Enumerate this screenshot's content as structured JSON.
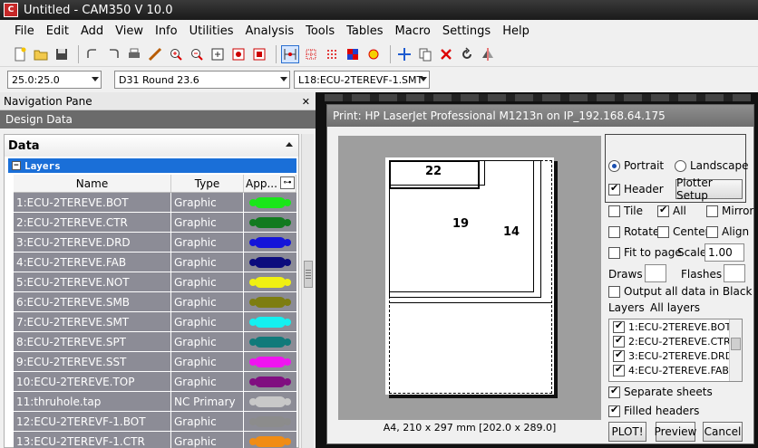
{
  "window": {
    "title": "Untitled - CAM350 V 10.0",
    "app_icon": "cam350-icon"
  },
  "menu": [
    "File",
    "Edit",
    "Add",
    "View",
    "Info",
    "Utilities",
    "Analysis",
    "Tools",
    "Tables",
    "Macro",
    "Settings",
    "Help"
  ],
  "toolbar": {
    "icons": [
      "new-icon",
      "open-icon",
      "save-icon",
      "undo-icon",
      "redo-icon",
      "print-icon",
      "measure-icon",
      "zoom-in-icon",
      "zoom-out-icon",
      "zoom-window-icon",
      "zoom-all-icon",
      "redraw-icon",
      "snap-grid-icon",
      "grid-icon",
      "grid-dots-icon",
      "layer-color-icon",
      "highlight-icon",
      "move-icon",
      "copy-icon",
      "delete-icon",
      "rotate-icon",
      "mirror-icon"
    ]
  },
  "selectors": {
    "grid": "25.0:25.0",
    "aperture": "D31   Round 23.6",
    "layer": "L18:ECU-2TEREVF-1.SMT"
  },
  "nav": {
    "title": "Navigation Pane",
    "section": "Design Data",
    "data_label": "Data",
    "layers_label": "Layers",
    "columns": [
      "Name",
      "Type",
      "App..."
    ],
    "rows": [
      {
        "name": "1:ECU-2TEREVE.BOT",
        "type": "Graphic",
        "color": "#19e619"
      },
      {
        "name": "2:ECU-2TEREVE.CTR",
        "type": "Graphic",
        "color": "#127a1f"
      },
      {
        "name": "3:ECU-2TEREVE.DRD",
        "type": "Graphic",
        "color": "#1414d9"
      },
      {
        "name": "4:ECU-2TEREVE.FAB",
        "type": "Graphic",
        "color": "#0c0c7d"
      },
      {
        "name": "5:ECU-2TEREVE.NOT",
        "type": "Graphic",
        "color": "#f0f012"
      },
      {
        "name": "6:ECU-2TEREVE.SMB",
        "type": "Graphic",
        "color": "#7d7d10"
      },
      {
        "name": "7:ECU-2TEREVE.SMT",
        "type": "Graphic",
        "color": "#14f0f0"
      },
      {
        "name": "8:ECU-2TEREVE.SPT",
        "type": "Graphic",
        "color": "#117a7a"
      },
      {
        "name": "9:ECU-2TEREVE.SST",
        "type": "Graphic",
        "color": "#f014f0"
      },
      {
        "name": "10:ECU-2TEREVE.TOP",
        "type": "Graphic",
        "color": "#800e80"
      },
      {
        "name": "11:thruhole.tap",
        "type": "NC Primary",
        "color": "#c8c8c8"
      },
      {
        "name": "12:ECU-2TEREVF-1.BOT",
        "type": "Graphic",
        "color": "#8c8c8c"
      },
      {
        "name": "13:ECU-2TEREVF-1.CTR",
        "type": "Graphic",
        "color": "#f08c14"
      }
    ]
  },
  "print_dialog": {
    "title": "Print: HP LaserJet Professional M1213n on IP_192.168.64.175",
    "preview_labels": [
      "22",
      "19",
      "14"
    ],
    "paper_info": "A4, 210 x 297 mm [202.0 x 289.0]",
    "portrait": "Portrait",
    "landscape": "Landscape",
    "header": "Header",
    "plotter_setup": "Plotter Setup",
    "tile": "Tile",
    "all": "All",
    "mirror": "Mirror",
    "rotate": "Rotate",
    "center": "Center",
    "align": "Align",
    "fit_to_page": "Fit to page",
    "scale_label": "Scale",
    "scale_value": "1.00",
    "draws_label": "Draws",
    "flashes_label": "Flashes",
    "output_black": "Output all data in Black",
    "layers_label": "Layers",
    "layers_value": "All layers",
    "layer_items": [
      "1:ECU-2TEREVE.BOT",
      "2:ECU-2TEREVE.CTR",
      "3:ECU-2TEREVE.DRD",
      "4:ECU-2TEREVE.FAB"
    ],
    "separate_sheets": "Separate sheets",
    "filled_headers": "Filled headers",
    "plot_btn": "PLOT!",
    "preview_btn": "Preview",
    "cancel_btn": "Cancel"
  }
}
